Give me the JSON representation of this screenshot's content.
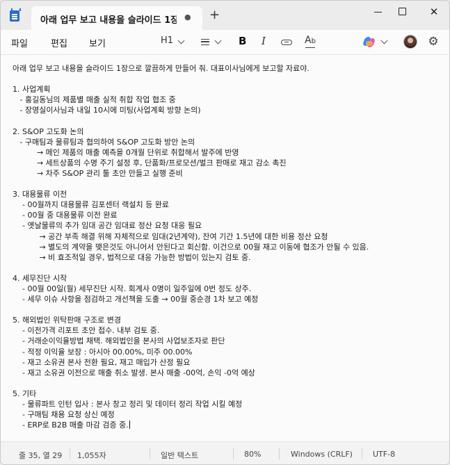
{
  "tab": {
    "title": "아래 업무 보고 내용을 슬라이드 1장.",
    "dirty_marker": "●",
    "new_tab": "+"
  },
  "window": {
    "minimize": "",
    "maximize": "",
    "close": "✕"
  },
  "menu": {
    "file": "파일",
    "edit": "편집",
    "view": "보기"
  },
  "toolbar": {
    "heading": "H1",
    "list_icon": "list-icon",
    "bold": "B",
    "italic": "I",
    "link_icon": "link-icon",
    "spell_check": "A̶ᵇ",
    "copilot_icon": "copilot-icon",
    "avatar": "avatar",
    "settings_icon": "⚙"
  },
  "document": {
    "lines": [
      "아래 업무 보고 내용을 슬라이드 1장으로 깔끔하게 만들어 줘. 대표이사님에게 보고할 자료야.",
      "",
      "1. 사업계획",
      "   - 홍길동님의 제품별 매출 실적 취합 작업 협조 중",
      "   - 장영실이사님과 내일 10시에 미팅(사업계획 방향 논의)",
      "",
      "2. S&OP 고도화 논의",
      "   - 구매팀과 물류팀과 협의하여 S&OP 고도화 방안 논의",
      "          → 메인 제품의 매출 예측을 0개월 단위로 취합해서 발주에 반영",
      "          → 세트상품의 수명 주기 설정 후, 단품화/프로모션/벌크 판매로 재고 감소 촉진",
      "          → 차주 S&OP 관리 툴 초안 만들고 실행 준비",
      "",
      "3. 대용물류 이전",
      "    - 00월까지 대용물류 김포센터 랙설치 등 완료",
      "    - 00월 중 대용물류 이전 완료",
      "    - 옛날물류의 추가 임대 공간 임대료 정산 요청 대응 필요",
      "           → 공간 부족 해결 위해 자체적으로 임대(2년계약), 잔여 기간 1.5년에 대한 비용 정산 요청",
      "           → 별도의 계약을 맺은것도 아니어서 안된다고 회신함. 이건으로 00월 재고 이동에 협조가 안될 수 있음.",
      "           → 비 효조적일 경우, 법적으로 대응 가능한 방법이 있는지 검토 중.",
      "",
      "4. 세무진단 시작",
      "    - 00월 00일(월) 세무진단 시작. 회계사 0명이 일주일에 0번 정도 상주.",
      "    - 세무 이슈 사항을 점검하고 개선책을 도출 → 00월 중순경 1차 보고 예정",
      "",
      "5. 해외법인 위탁판매 구조로 변경",
      "    - 이전가격 리포트 초안 접수. 내부 검토 중.",
      "    - 거래순이익율방법 채택. 해외법인을 본사의 사업보조자로 판단",
      "    - 적정 이익율 보장 : 아시아 00.00%, 미주 00.00%",
      "    - 재고 소유권 본사 전환 필요, 재고 매입가 산정 필요",
      "    - 재고 소유권 이전으로 매출 취소 발생. 본사 매출 -00억, 손익 -0억 예상",
      "",
      "5. 기타",
      "    - 물류파트 인턴 입사 : 본사 창고 정리 및 데이터 정리 작업 시킬 예정",
      "    - 구매팀 채용 요청 상신 예정",
      "    - ERP로 B2B 매출 마감 검증 중."
    ]
  },
  "status": {
    "position": "줄 35, 열 29",
    "char_count": "1,055자",
    "format": "일반 텍스트",
    "zoom": "80%",
    "line_ending": "Windows (CRLF)",
    "encoding": "UTF-8"
  }
}
